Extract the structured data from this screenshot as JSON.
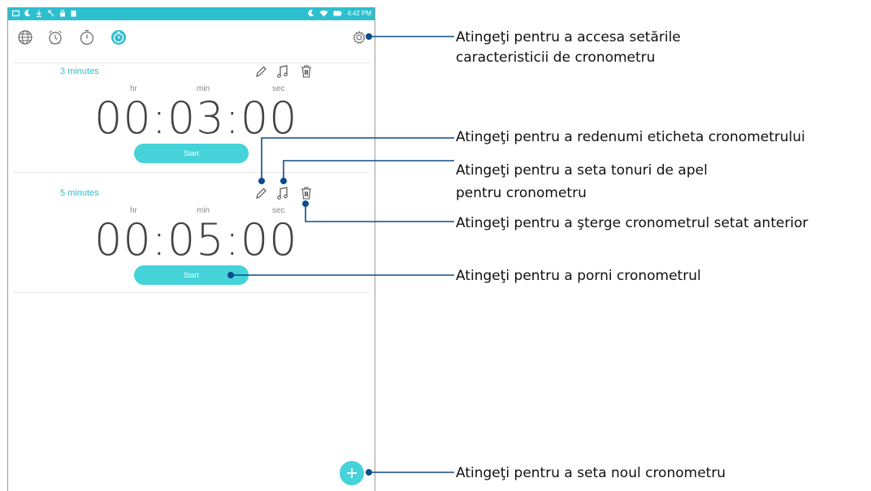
{
  "status_bar": {
    "time": "4:42 PM",
    "accent": "#2dbfcf",
    "left_icons": [
      "message-icon",
      "moon-icon",
      "download-icon",
      "missed-call-icon",
      "lock-icon",
      "clipboard-icon"
    ],
    "right_icons": [
      "moon-icon",
      "wifi-icon",
      "battery-icon"
    ]
  },
  "tabs": [
    {
      "name": "world-clock",
      "icon": "globe-icon",
      "active": false
    },
    {
      "name": "alarm",
      "icon": "alarm-icon",
      "active": false
    },
    {
      "name": "stopwatch",
      "icon": "stopwatch-icon",
      "active": false
    },
    {
      "name": "timer",
      "icon": "timer-icon",
      "active": true
    }
  ],
  "timers": [
    {
      "label": "3 minutes",
      "units": {
        "hr": "hr",
        "min": "min",
        "sec": "sec"
      },
      "time": "00:03:00",
      "start_label": "Start"
    },
    {
      "label": "5 minutes",
      "units": {
        "hr": "hr",
        "min": "min",
        "sec": "sec"
      },
      "time": "00:05:00",
      "start_label": "Start"
    }
  ],
  "callouts": {
    "settings_line1": "Atingeţi pentru a accesa setările",
    "settings_line2": "caracteristicii de cronometru",
    "rename": "Atingeţi pentru a redenumi eticheta cronometrului",
    "ringtone_line1": "Atingeţi pentru a seta tonuri de apel",
    "ringtone_line2": "pentru cronometru",
    "delete": "Atingeţi pentru a şterge cronometrul setat anterior",
    "start": "Atingeţi pentru a porni cronometrul",
    "new_timer": "Atingeţi pentru a seta noul cronometru"
  },
  "colors": {
    "accent": "#45d2d8",
    "callout_line": "#0d4a8a"
  }
}
